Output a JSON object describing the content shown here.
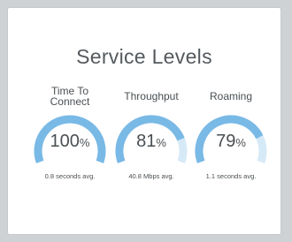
{
  "card": {
    "title": "Service Levels"
  },
  "metrics": [
    {
      "label_line1": "Time To",
      "label_line2": "Connect",
      "value": "100",
      "unit": "%",
      "fill_fraction": 1.0,
      "subtext": "0.8 seconds avg."
    },
    {
      "label_line1": "Throughput",
      "label_line2": "",
      "value": "81",
      "unit": "%",
      "fill_fraction": 0.81,
      "subtext": "40.8 Mbps avg."
    },
    {
      "label_line1": "Roaming",
      "label_line2": "",
      "value": "79",
      "unit": "%",
      "fill_fraction": 0.79,
      "subtext": "1.1 seconds avg."
    }
  ],
  "colors": {
    "gauge_fill": "#79b9e6",
    "gauge_track": "#d6e9f7",
    "text": "#4a4f53"
  }
}
